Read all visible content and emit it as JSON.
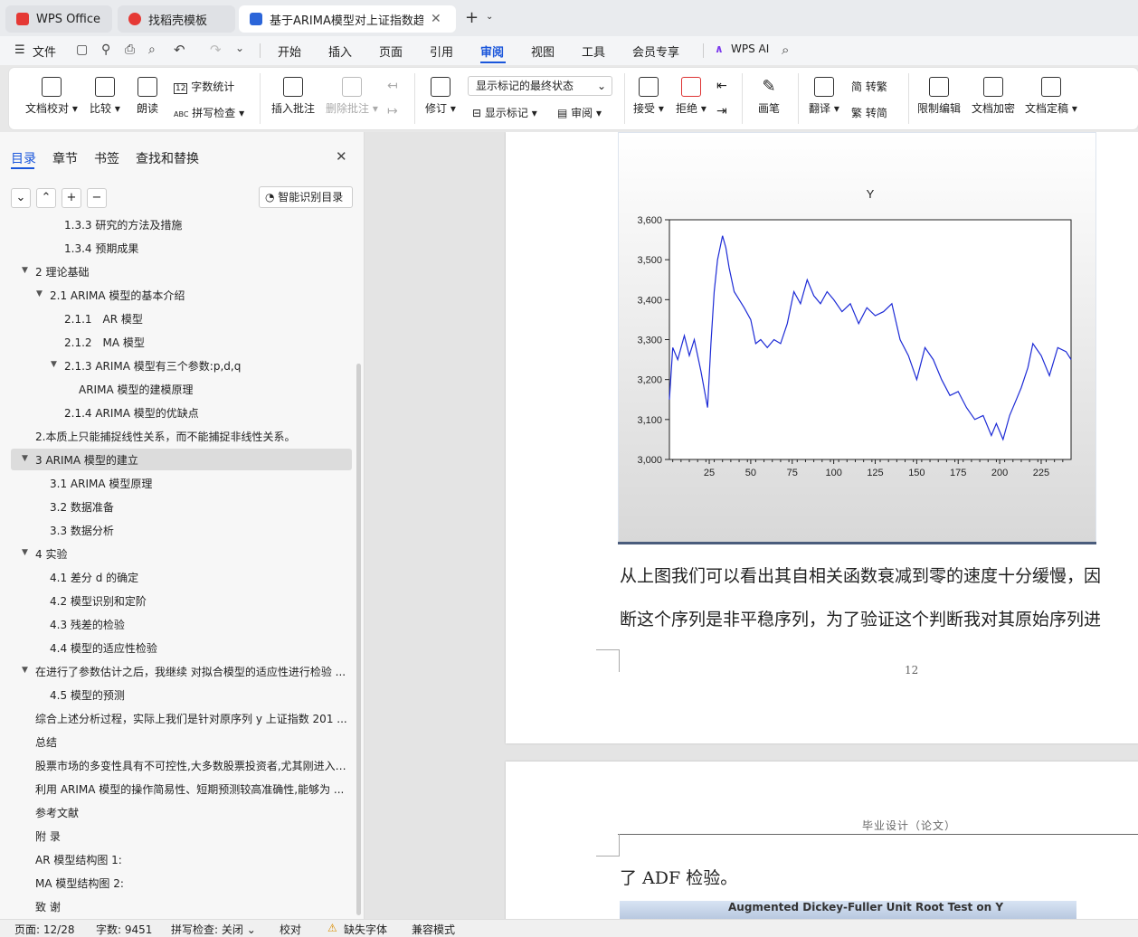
{
  "tabs": [
    {
      "label": "WPS Office"
    },
    {
      "label": "找稻壳模板"
    },
    {
      "label": "基于ARIMA模型对上证指数趋"
    }
  ],
  "menu": {
    "file": "文件",
    "items": [
      "开始",
      "插入",
      "页面",
      "引用",
      "审阅",
      "视图",
      "工具",
      "会员专享"
    ],
    "ai": "WPS AI"
  },
  "ribbon": {
    "proofread": "文档校对",
    "compare": "比较",
    "read": "朗读",
    "wordcount": "字数统计",
    "spellcheck": "拼写检查",
    "insert_comment": "插入批注",
    "delete_comment": "删除批注",
    "revise": "修订",
    "markup_select": "显示标记的最终状态",
    "show_markup": "显示标记",
    "review": "审阅",
    "accept": "接受",
    "reject": "拒绝",
    "pen": "画笔",
    "translate": "翻译",
    "to_traditional": "转繁",
    "to_simplified": "转简",
    "restrict": "限制编辑",
    "encrypt": "文档加密",
    "finalize": "文档定稿"
  },
  "sidebar": {
    "tabs": [
      "目录",
      "章节",
      "书签",
      "查找和替换"
    ],
    "smart_btn": "智能识别目录",
    "items": [
      {
        "text": "1.3.3 研究的方法及措施"
      },
      {
        "text": "1.3.4 预期成果"
      },
      {
        "text": "2 理论基础"
      },
      {
        "text": "2.1 ARIMA 模型的基本介绍"
      },
      {
        "text": "2.1.1　AR 模型"
      },
      {
        "text": "2.1.2　MA 模型"
      },
      {
        "text": "2.1.3 ARIMA 模型有三个参数:p,d,q"
      },
      {
        "text": "ARIMA 模型的建模原理"
      },
      {
        "text": "2.1.4 ARIMA 模型的优缺点"
      },
      {
        "text": "2.本质上只能捕捉线性关系，而不能捕捉非线性关系。"
      },
      {
        "text": "3 ARIMA 模型的建立"
      },
      {
        "text": "3.1 ARIMA 模型原理"
      },
      {
        "text": "3.2  数据准备"
      },
      {
        "text": "3.3  数据分析"
      },
      {
        "text": "4  实验"
      },
      {
        "text": "4.1  差分 d 的确定"
      },
      {
        "text": "4.2 模型识别和定阶"
      },
      {
        "text": "4.3  残差的检验"
      },
      {
        "text": "4.4 模型的适应性检验"
      },
      {
        "text": "在进行了参数估计之后，我继续 对拟合模型的适应性进行检验 ..."
      },
      {
        "text": "4.5 模型的预测"
      },
      {
        "text": "综合上述分析过程，实际上我们是针对原序列 y 上证指数 201 ..."
      },
      {
        "text": "总结"
      },
      {
        "text": "股票市场的多变性具有不可控性,大多数股票投资者,尤其刚进入 ..."
      },
      {
        "text": "利用 ARIMA 模型的操作简易性、短期预测较高准确性,能够为 ..."
      },
      {
        "text": "参考文献"
      },
      {
        "text": "附  录"
      },
      {
        "text": "AR 模型结构图 1:"
      },
      {
        "text": "MA 模型结构图 2:"
      },
      {
        "text": "致  谢"
      }
    ]
  },
  "document": {
    "para1_line1": "从上图我们可以看出其自相关函数衰减到零的速度十分缓慢，因",
    "para1_line2": "断这个序列是非平稳序列，为了验证这个判断我对其原始序列进",
    "page_number": "12",
    "header": "毕业设计（论文）",
    "para2": "了 ADF 检验。",
    "table_caption": "Augmented Dickey-Fuller Unit Root Test on Y"
  },
  "chart_data": {
    "type": "line",
    "title": "Y",
    "xlim": [
      1,
      243
    ],
    "ylim": [
      3000,
      3600
    ],
    "xticks": [
      25,
      50,
      75,
      100,
      125,
      150,
      175,
      200,
      225
    ],
    "yticks": [
      "3,000",
      "3,100",
      "3,200",
      "3,300",
      "3,400",
      "3,500",
      "3,600"
    ],
    "x": [
      1,
      3,
      6,
      10,
      13,
      16,
      20,
      24,
      26,
      28,
      30,
      33,
      35,
      37,
      40,
      43,
      46,
      50,
      53,
      56,
      60,
      64,
      68,
      72,
      76,
      80,
      84,
      88,
      92,
      96,
      100,
      105,
      110,
      115,
      120,
      125,
      130,
      135,
      140,
      145,
      150,
      155,
      160,
      165,
      170,
      175,
      180,
      185,
      190,
      195,
      198,
      202,
      206,
      210,
      213,
      217,
      220,
      225,
      230,
      235,
      240,
      243
    ],
    "series": [
      {
        "values": [
          3150,
          3280,
          3250,
          3310,
          3260,
          3300,
          3220,
          3130,
          3290,
          3420,
          3500,
          3560,
          3530,
          3480,
          3420,
          3400,
          3380,
          3350,
          3290,
          3300,
          3280,
          3300,
          3290,
          3340,
          3420,
          3390,
          3450,
          3410,
          3390,
          3420,
          3400,
          3370,
          3390,
          3340,
          3380,
          3360,
          3370,
          3390,
          3300,
          3260,
          3200,
          3280,
          3250,
          3200,
          3160,
          3170,
          3130,
          3100,
          3110,
          3060,
          3090,
          3050,
          3110,
          3150,
          3180,
          3230,
          3290,
          3260,
          3210,
          3280,
          3270,
          3250
        ]
      }
    ]
  }
}
